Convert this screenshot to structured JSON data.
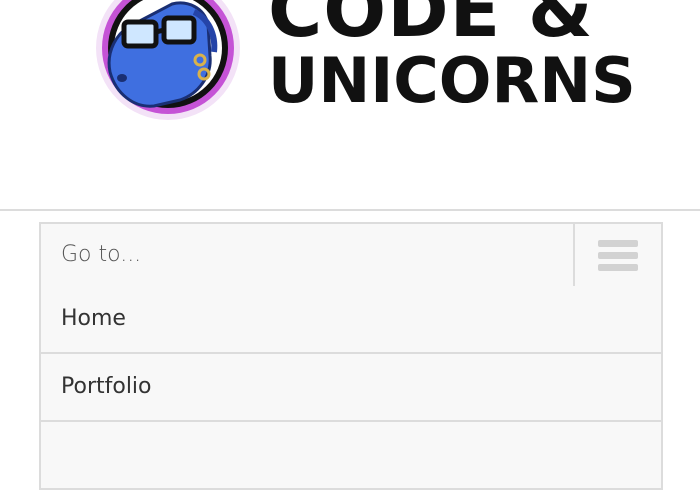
{
  "site": {
    "logo_line1": "CODE &",
    "logo_line2": "UNICORNS",
    "logo_icon": "unicorn-mascot-with-glasses",
    "brand_colors": {
      "unicorn_blue": "#3f6fe0",
      "glow_purple": "#b026c9",
      "text_black": "#111111"
    }
  },
  "nav": {
    "goto_label": "Go to...",
    "toggle_icon": "hamburger-menu-icon",
    "items": [
      {
        "label": "Home"
      },
      {
        "label": "Portfolio"
      },
      {
        "label": ""
      }
    ]
  },
  "colors": {
    "background": "#ffffff",
    "menu_bg": "#f8f8f8",
    "border": "#dcdcdc",
    "icon": "#d2d2d2"
  }
}
